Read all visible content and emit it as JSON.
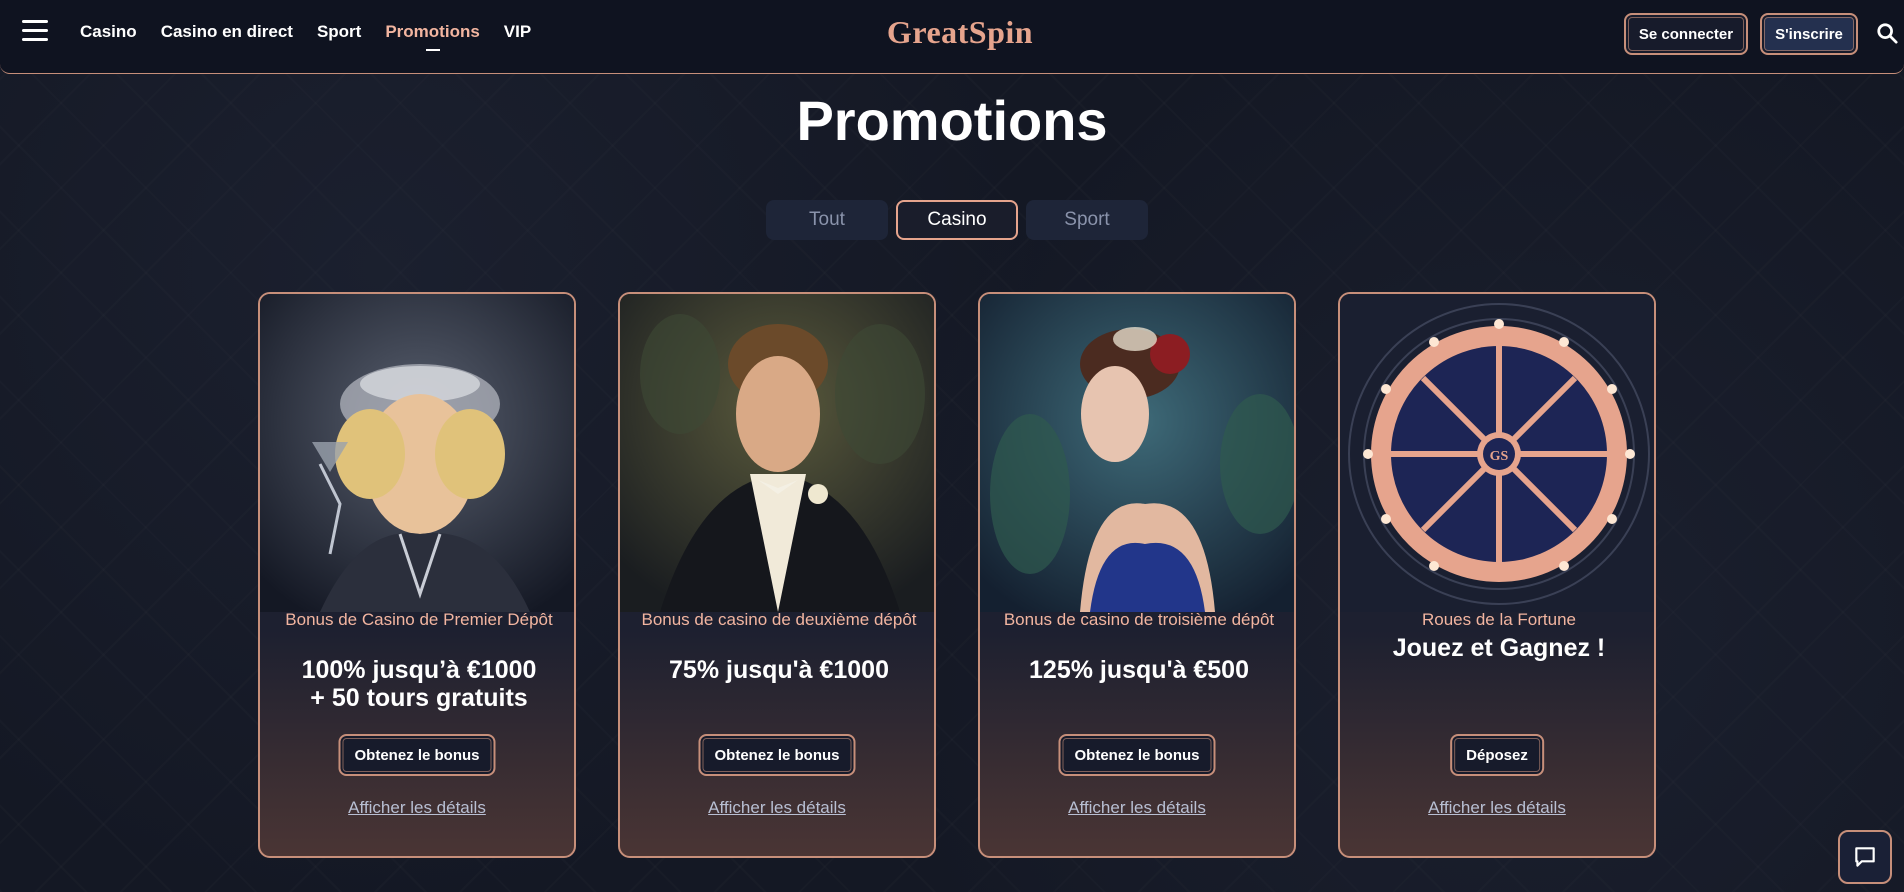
{
  "header": {
    "nav": [
      "Casino",
      "Casino en direct",
      "Sport",
      "Promotions",
      "VIP"
    ],
    "active_nav": "Promotions",
    "logo": "GreatSpin",
    "login_label": "Se connecter",
    "signup_label": "S'inscrire"
  },
  "page": {
    "title": "Promotions"
  },
  "tabs": [
    {
      "label": "Tout",
      "active": false
    },
    {
      "label": "Casino",
      "active": true
    },
    {
      "label": "Sport",
      "active": false
    }
  ],
  "cards": [
    {
      "subtitle": "Bonus de Casino de Premier Dépôt",
      "headline_1": "100% jusqu’à €1000",
      "headline_2": "+ 50 tours gratuits",
      "button": "Obtenez le bonus",
      "link": "Afficher les détails",
      "image": "flapper-woman-with-cocktail"
    },
    {
      "subtitle": "Bonus de casino de deuxième dépôt",
      "headline_1": "75% jusqu'à €1000",
      "headline_2": "",
      "button": "Obtenez le bonus",
      "link": "Afficher les détails",
      "image": "man-in-tuxedo"
    },
    {
      "subtitle": "Bonus de casino de troisième dépôt",
      "headline_1": "125% jusqu'à €500",
      "headline_2": "",
      "button": "Obtenez le bonus",
      "link": "Afficher les détails",
      "image": "woman-with-red-rose"
    },
    {
      "subtitle": "Roues de la Fortune",
      "headline_1": "Jouez et Gagnez !",
      "headline_2": "",
      "button": "Déposez",
      "link": "Afficher les détails",
      "image": "fortune-wheel"
    }
  ],
  "colors": {
    "accent": "#e6a48d",
    "border": "#c78f7a",
    "background": "#141824",
    "header_bg": "#0f1320"
  }
}
